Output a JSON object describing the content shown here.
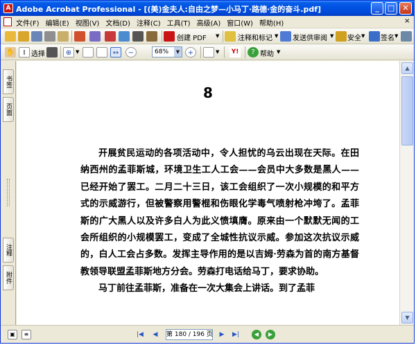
{
  "window": {
    "title": "Adobe Acrobat Professional - [(美)金夫人:自由之梦—小马丁·路德·金的奋斗.pdf]",
    "min_label": "_",
    "max_label": "□",
    "close_label": "✕"
  },
  "menu": {
    "items": [
      "文件(F)",
      "编辑(E)",
      "视图(V)",
      "文档(D)",
      "注释(C)",
      "工具(T)",
      "高级(A)",
      "窗口(W)",
      "帮助(H)"
    ],
    "close_glyph": "×"
  },
  "toolbar1": {
    "create_pdf": "创建 PDF",
    "comment_markup": "注释和标记",
    "send_review": "发送供审阅",
    "security": "安全",
    "sign": "签名"
  },
  "toolbar2": {
    "select_label": "选择",
    "zoom_value": "68%",
    "help_label": "帮助"
  },
  "navpane": {
    "tab_bookmarks": "书签",
    "tab_pages": "页面",
    "tab_comments": "注释",
    "tab_attachments": "附件"
  },
  "document": {
    "page_number": "8",
    "paragraphs": [
      "开展贫民运动的各项活动中，令人担忧的乌云出现在天际。在田纳西州的孟菲斯城，环境卫生工人工会——会员中大多数是黑人——已经开始了罢工。二月二十三日，该工会组织了一次小规模的和平方式的示威游行，但被警察用警棍和伤眼化学毒气喷射枪冲垮了。孟菲斯的广大黑人以及许多白人为此义愤填膺。原来由一个默默无闻的工会所组织的小规模罢工，变成了全城性抗议示威。参加这次抗议示威的，白人工会占多数。发挥主导作用的是以吉姆·劳森为首的南方基督教领导联盟孟菲斯地方分会。劳森打电话给马丁，要求协助。",
      "马丁前往孟菲斯，准备在一次大集会上讲话。到了孟菲"
    ]
  },
  "statusbar": {
    "page_indicator": "第 180 / 196 页"
  }
}
